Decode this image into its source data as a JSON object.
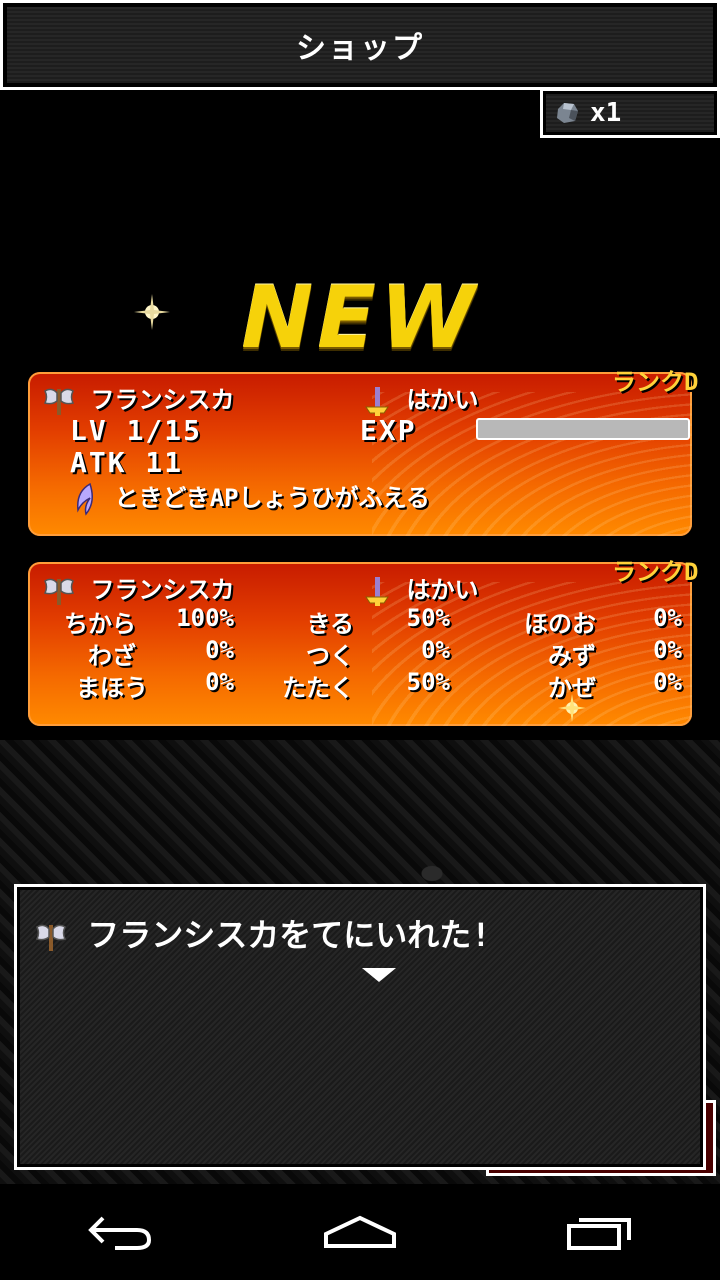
{
  "header": {
    "title": "ショップ"
  },
  "currency": {
    "icon": "ore-icon",
    "count": "x1"
  },
  "banner": {
    "text": "NEW"
  },
  "weapon_card": {
    "rank": "ランクD",
    "name": "フランシスカ",
    "type": "はかい",
    "level_label": "LV 1/15",
    "exp_label": "EXP",
    "exp_progress": 0,
    "atk_label": "ATK 11",
    "skill": "ときどきAPしょうひがふえる"
  },
  "stats_card": {
    "rank": "ランクD",
    "name": "フランシスカ",
    "type": "はかい",
    "stats": [
      {
        "label": "ちから",
        "value": "100%"
      },
      {
        "label": "わざ",
        "value": "0%"
      },
      {
        "label": "まほう",
        "value": "0%"
      },
      {
        "label": "きる",
        "value": "50%"
      },
      {
        "label": "つく",
        "value": "0%"
      },
      {
        "label": "たたく",
        "value": "50%"
      },
      {
        "label": "ほのお",
        "value": "0%"
      },
      {
        "label": "みず",
        "value": "0%"
      },
      {
        "label": "かぜ",
        "value": "0%"
      }
    ]
  },
  "message": {
    "text": "フランシスカをてにいれた!"
  },
  "colors": {
    "card_top": "#c71b00",
    "card_bottom": "#ff8a00",
    "rank": "#ffd23a",
    "logo": "#f6d20a"
  },
  "navbar": {
    "back": "back-icon",
    "home": "home-icon",
    "recents": "recents-icon"
  }
}
